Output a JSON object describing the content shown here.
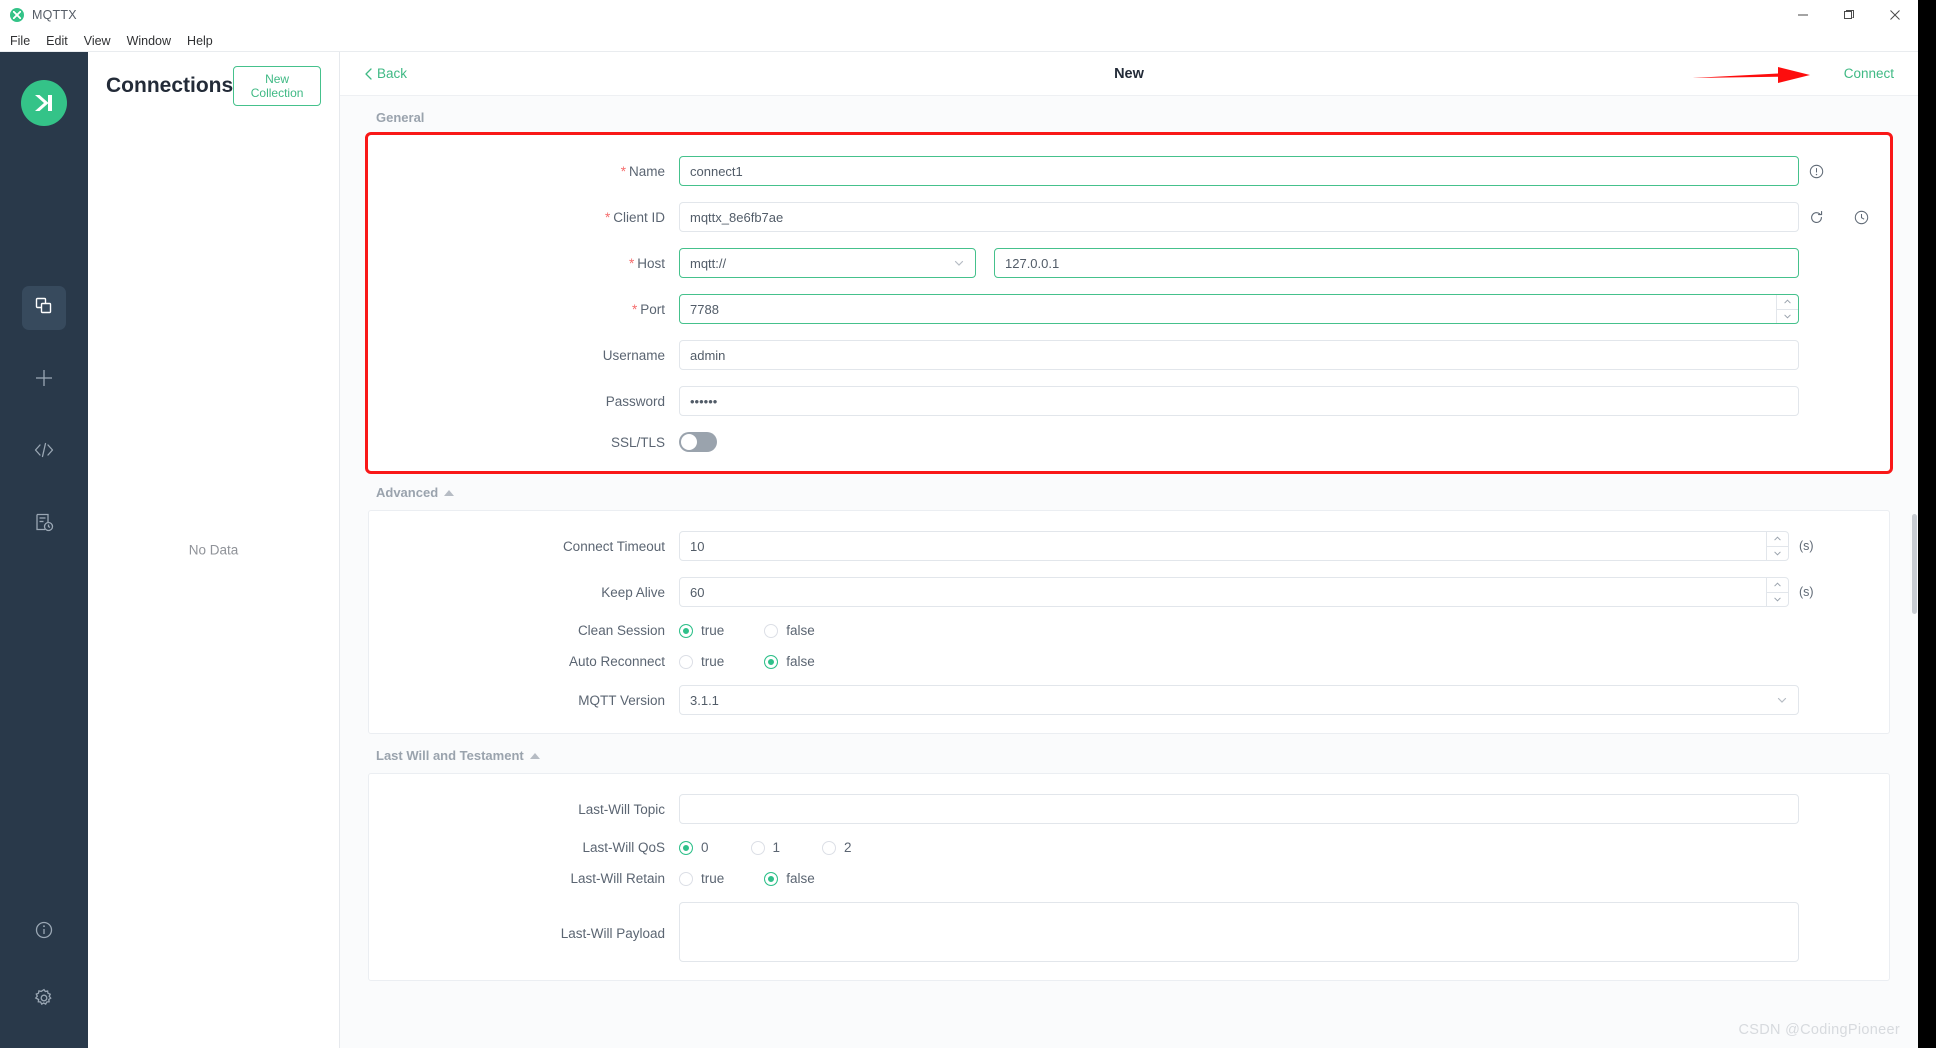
{
  "window": {
    "title": "MQTTX",
    "logo_icon": "mqttx-logo-icon",
    "minimize_icon": "minimize-icon",
    "maximize_icon": "maximize-icon",
    "close_icon": "close-icon"
  },
  "menubar": {
    "items": [
      {
        "label": "File"
      },
      {
        "label": "Edit"
      },
      {
        "label": "View"
      },
      {
        "label": "Window"
      },
      {
        "label": "Help"
      }
    ]
  },
  "rail": {
    "items": [
      {
        "icon": "connections-icon",
        "active": true
      },
      {
        "icon": "plus-icon",
        "active": false
      },
      {
        "icon": "code-icon",
        "active": false
      },
      {
        "icon": "log-icon",
        "active": false
      }
    ],
    "bottom_items": [
      {
        "icon": "info-icon"
      },
      {
        "icon": "gear-icon"
      }
    ]
  },
  "connections": {
    "title": "Connections",
    "new_collection_label": "New Collection",
    "empty_text": "No Data"
  },
  "header": {
    "back_label": "Back",
    "title": "New",
    "connect_label": "Connect",
    "annotation_arrow": "red-arrow-annotation"
  },
  "general": {
    "section_label": "General",
    "fields": {
      "name": {
        "label": "Name",
        "required": true,
        "value": "connect1",
        "info_icon": "info-circle-icon"
      },
      "client_id": {
        "label": "Client ID",
        "required": true,
        "value": "mqttx_8e6fb7ae",
        "refresh_icon": "refresh-icon",
        "history_icon": "clock-icon"
      },
      "host": {
        "label": "Host",
        "required": true,
        "protocol": "mqtt://",
        "value": "127.0.0.1",
        "caret_icon": "chevron-down-icon"
      },
      "port": {
        "label": "Port",
        "required": true,
        "value": "7788"
      },
      "username": {
        "label": "Username",
        "required": false,
        "value": "admin"
      },
      "password": {
        "label": "Password",
        "required": false,
        "value": "••••••"
      },
      "ssl_tls": {
        "label": "SSL/TLS",
        "required": false,
        "enabled": false
      }
    }
  },
  "advanced": {
    "section_label": "Advanced",
    "collapse_icon": "caret-up-icon",
    "fields": {
      "connect_timeout": {
        "label": "Connect Timeout",
        "value": "10",
        "suffix": "(s)"
      },
      "keep_alive": {
        "label": "Keep Alive",
        "value": "60",
        "suffix": "(s)"
      },
      "clean_session": {
        "label": "Clean Session",
        "options": [
          "true",
          "false"
        ],
        "selected": "true"
      },
      "auto_reconnect": {
        "label": "Auto Reconnect",
        "options": [
          "true",
          "false"
        ],
        "selected": "false"
      },
      "mqtt_version": {
        "label": "MQTT Version",
        "value": "3.1.1",
        "caret_icon": "chevron-down-icon"
      }
    }
  },
  "last_will": {
    "section_label": "Last Will and Testament",
    "collapse_icon": "caret-up-icon",
    "fields": {
      "topic": {
        "label": "Last-Will Topic",
        "value": "",
        "placeholder": ""
      },
      "qos": {
        "label": "Last-Will QoS",
        "options": [
          "0",
          "1",
          "2"
        ],
        "selected": "0"
      },
      "retain": {
        "label": "Last-Will Retain",
        "options": [
          "true",
          "false"
        ],
        "selected": "false"
      },
      "payload": {
        "label": "Last-Will Payload",
        "value": ""
      }
    }
  },
  "watermark": {
    "text": "CSDN @CodingPioneer"
  },
  "colors": {
    "accent_green": "#3fb984",
    "rail_bg": "#29394a",
    "annotation_red": "#f91818",
    "required_red": "#f56c6c"
  }
}
